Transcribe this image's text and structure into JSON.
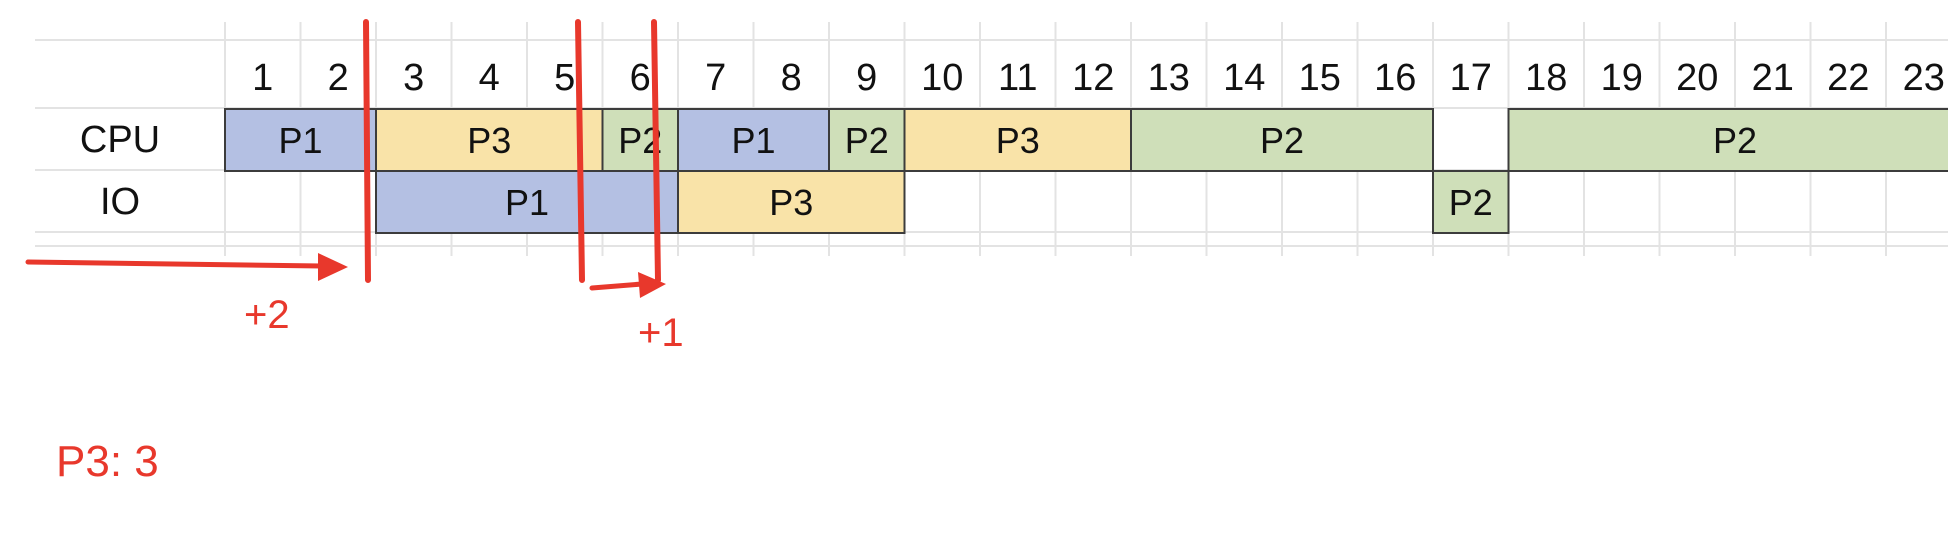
{
  "timeline": {
    "columns": [
      "1",
      "2",
      "3",
      "4",
      "5",
      "6",
      "7",
      "8",
      "9",
      "10",
      "11",
      "12",
      "13",
      "14",
      "15",
      "16",
      "17",
      "18",
      "19",
      "20",
      "21",
      "22",
      "23"
    ],
    "rows": [
      {
        "label": "CPU",
        "bars": [
          {
            "text": "P1",
            "start": 1,
            "end": 2,
            "color": "#b4c0e3"
          },
          {
            "text": "P3",
            "start": 3,
            "end": 5,
            "color": "#f9e3a8"
          },
          {
            "text": "P2",
            "start": 6,
            "end": 6,
            "color": "#cfdfb9"
          },
          {
            "text": "P1",
            "start": 7,
            "end": 8,
            "color": "#b4c0e3"
          },
          {
            "text": "P2",
            "start": 9,
            "end": 9,
            "color": "#cfdfb9"
          },
          {
            "text": "P3",
            "start": 10,
            "end": 12,
            "color": "#f9e3a8"
          },
          {
            "text": "P2",
            "start": 13,
            "end": 16,
            "color": "#cfdfb9"
          },
          {
            "text": "P2",
            "start": 18,
            "end": 23,
            "color": "#cfdfb9"
          }
        ]
      },
      {
        "label": "IO",
        "bars": [
          {
            "text": "P1",
            "start": 3,
            "end": 6,
            "color": "#b4c0e3"
          },
          {
            "text": "P3",
            "start": 7,
            "end": 9,
            "color": "#f9e3a8"
          },
          {
            "text": "P2",
            "start": 17,
            "end": 17,
            "color": "#cfdfb9"
          }
        ]
      }
    ]
  },
  "annotations": {
    "color": "#e8382c",
    "label_plus2": "+2",
    "label_plus1": "+1",
    "note": "P3: 3"
  }
}
